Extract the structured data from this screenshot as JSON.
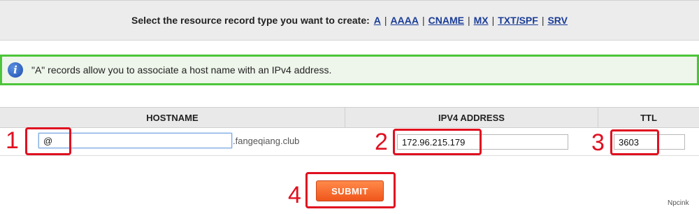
{
  "type_selector": {
    "prompt": "Select the resource record type you want to create:",
    "types": [
      {
        "label": "A"
      },
      {
        "label": "AAAA"
      },
      {
        "label": "CNAME"
      },
      {
        "label": "MX"
      },
      {
        "label": "TXT/SPF"
      },
      {
        "label": "SRV"
      }
    ],
    "separator": "|"
  },
  "info": {
    "icon": "info-icon",
    "icon_glyph": "i",
    "text": "\"A\" records allow you to associate a host name with an IPv4 address."
  },
  "table": {
    "headers": {
      "hostname": "HOSTNAME",
      "ipv4": "IPV4 ADDRESS",
      "ttl": "TTL"
    },
    "row": {
      "hostname_value": "@",
      "domain_suffix": ".fangeqiang.club",
      "ipv4_value": "172.96.215.179",
      "ttl_value": "3603"
    }
  },
  "callouts": {
    "1": "1",
    "2": "2",
    "3": "3",
    "4": "4"
  },
  "submit_label": "SUBMIT",
  "watermark": "Npcink",
  "colors": {
    "link": "#1a3c96",
    "info_border": "#4cc53a",
    "callout_red": "#e01020",
    "submit_orange": "#f0561b"
  }
}
